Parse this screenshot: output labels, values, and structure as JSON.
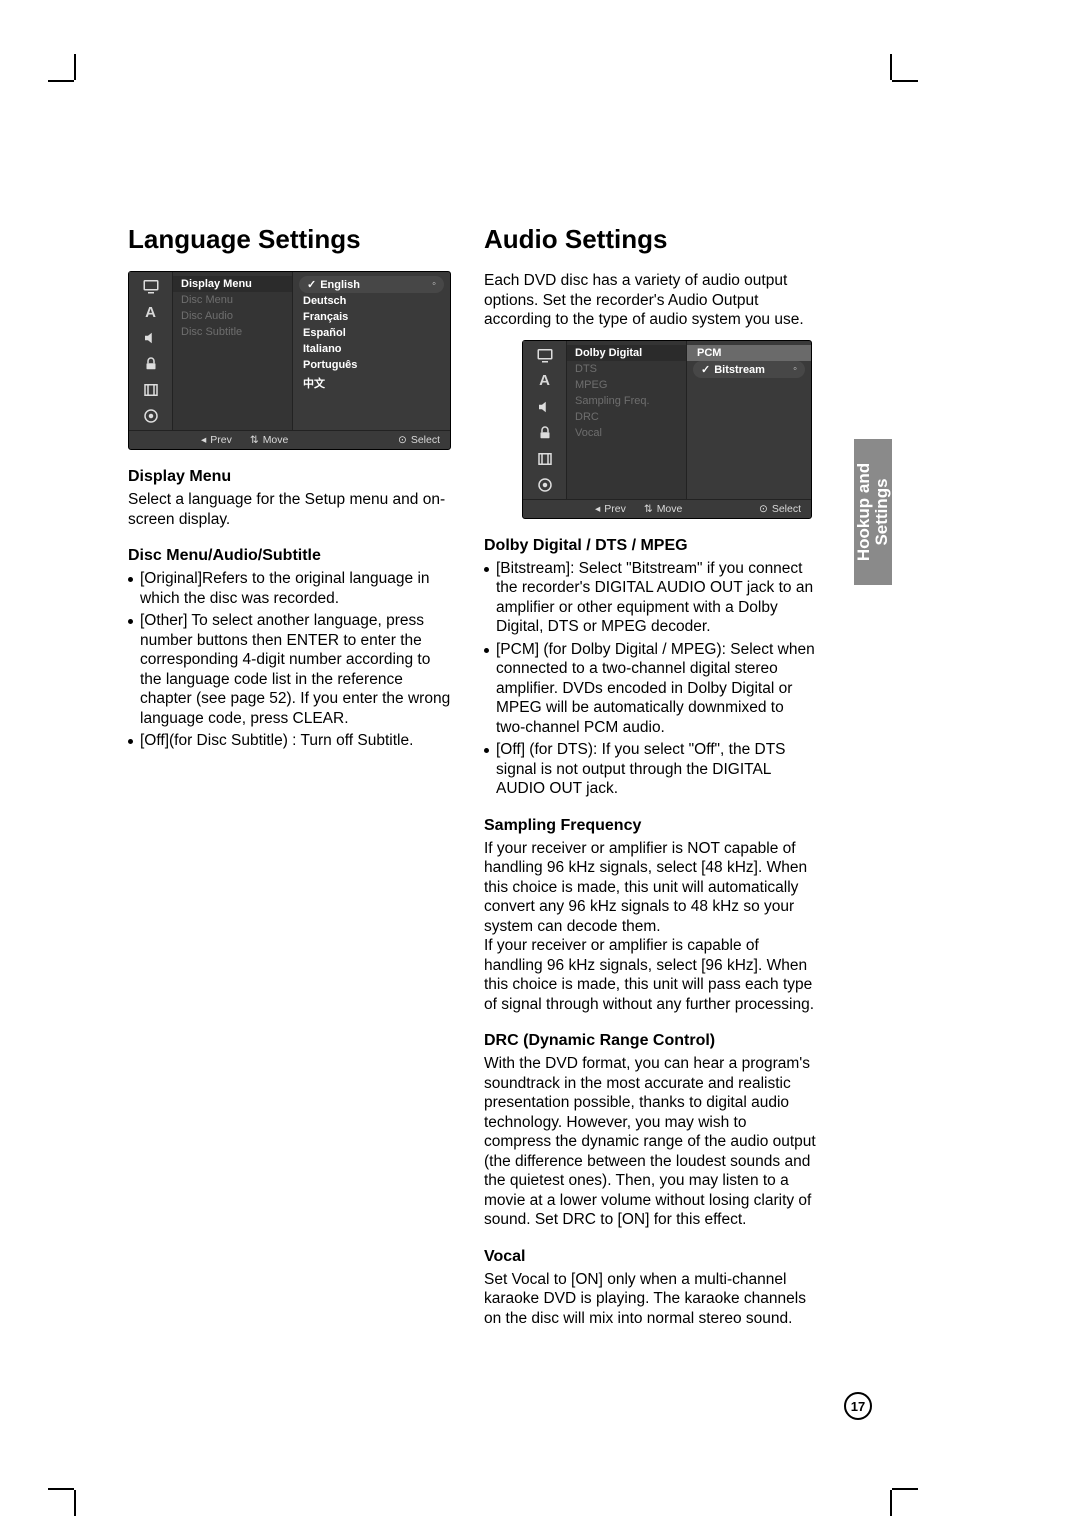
{
  "page_number": "17",
  "side_tab": {
    "line1": "Hookup and",
    "line2": "Settings"
  },
  "left": {
    "title": "Language Settings",
    "osd": {
      "menu_items": [
        {
          "label": "Display Menu",
          "active": true
        },
        {
          "label": "Disc Menu",
          "active": false
        },
        {
          "label": "Disc Audio",
          "active": false
        },
        {
          "label": "Disc Subtitle",
          "active": false
        }
      ],
      "options": [
        "English",
        "Deutsch",
        "Français",
        "Español",
        "Italiano",
        "Português",
        "中文"
      ],
      "selected": "English",
      "footer": {
        "prev": "Prev",
        "move": "Move",
        "select": "Select"
      }
    },
    "sections": [
      {
        "heading": "Display Menu",
        "paragraphs": [
          "Select a language for the Setup menu and on-screen display."
        ]
      },
      {
        "heading": "Disc Menu/Audio/Subtitle",
        "bullets": [
          "[Original]Refers to the original language in which the disc was recorded.",
          "[Other] To select another language, press number buttons then ENTER to enter the corresponding 4-digit number according to the language code list in the reference chapter (see page 52). If you enter the wrong language code, press CLEAR.",
          "[Off](for Disc Subtitle) : Turn off Subtitle."
        ]
      }
    ]
  },
  "right": {
    "title": "Audio Settings",
    "intro": "Each DVD disc has a variety of audio output options. Set the recorder's Audio Output according to the type of audio system you use.",
    "osd": {
      "menu_items": [
        {
          "label": "Dolby Digital",
          "active": true
        },
        {
          "label": "DTS",
          "active": false
        },
        {
          "label": "MPEG",
          "active": false
        },
        {
          "label": "Sampling Freq.",
          "active": false
        },
        {
          "label": "DRC",
          "active": false
        },
        {
          "label": "Vocal",
          "active": false
        }
      ],
      "header_option": "PCM",
      "options": [
        "Bitstream"
      ],
      "selected": "Bitstream",
      "footer": {
        "prev": "Prev",
        "move": "Move",
        "select": "Select"
      }
    },
    "sections": [
      {
        "heading": "Dolby Digital / DTS / MPEG",
        "bullets": [
          "[Bitstream]: Select \"Bitstream\" if you connect the recorder's DIGITAL AUDIO OUT jack to an amplifier or other equipment with a Dolby Digital, DTS or MPEG decoder.",
          "[PCM] (for Dolby Digital / MPEG): Select when connected to a two-channel digital stereo amplifier. DVDs encoded in Dolby Digital or MPEG will be automatically downmixed to two-channel PCM audio.",
          "[Off] (for DTS): If you select \"Off\", the DTS signal is not output through the DIGITAL AUDIO OUT jack."
        ]
      },
      {
        "heading": "Sampling Frequency",
        "paragraphs": [
          "If your receiver or amplifier is NOT capable of handling 96 kHz signals, select [48 kHz]. When this choice is made, this unit will automatically convert any 96 kHz signals to 48 kHz so your system can decode them.",
          "If your receiver or amplifier is capable of handling 96 kHz signals, select [96 kHz]. When this choice is made, this unit will pass each type of signal through without any further processing."
        ]
      },
      {
        "heading": "DRC (Dynamic Range Control)",
        "paragraphs": [
          "With the DVD format, you can hear a program's soundtrack in the most accurate and realistic presentation possible, thanks to digital audio technology. However, you may wish to compress the dynamic range of the audio output (the difference between the loudest sounds and the quietest ones). Then, you may listen to a movie at a lower volume without losing clarity of sound. Set DRC to [ON] for this effect."
        ]
      },
      {
        "heading": "Vocal",
        "paragraphs": [
          "Set Vocal to [ON] only when a multi-channel karaoke DVD is playing. The karaoke channels on the disc will mix into normal stereo sound."
        ]
      }
    ]
  }
}
